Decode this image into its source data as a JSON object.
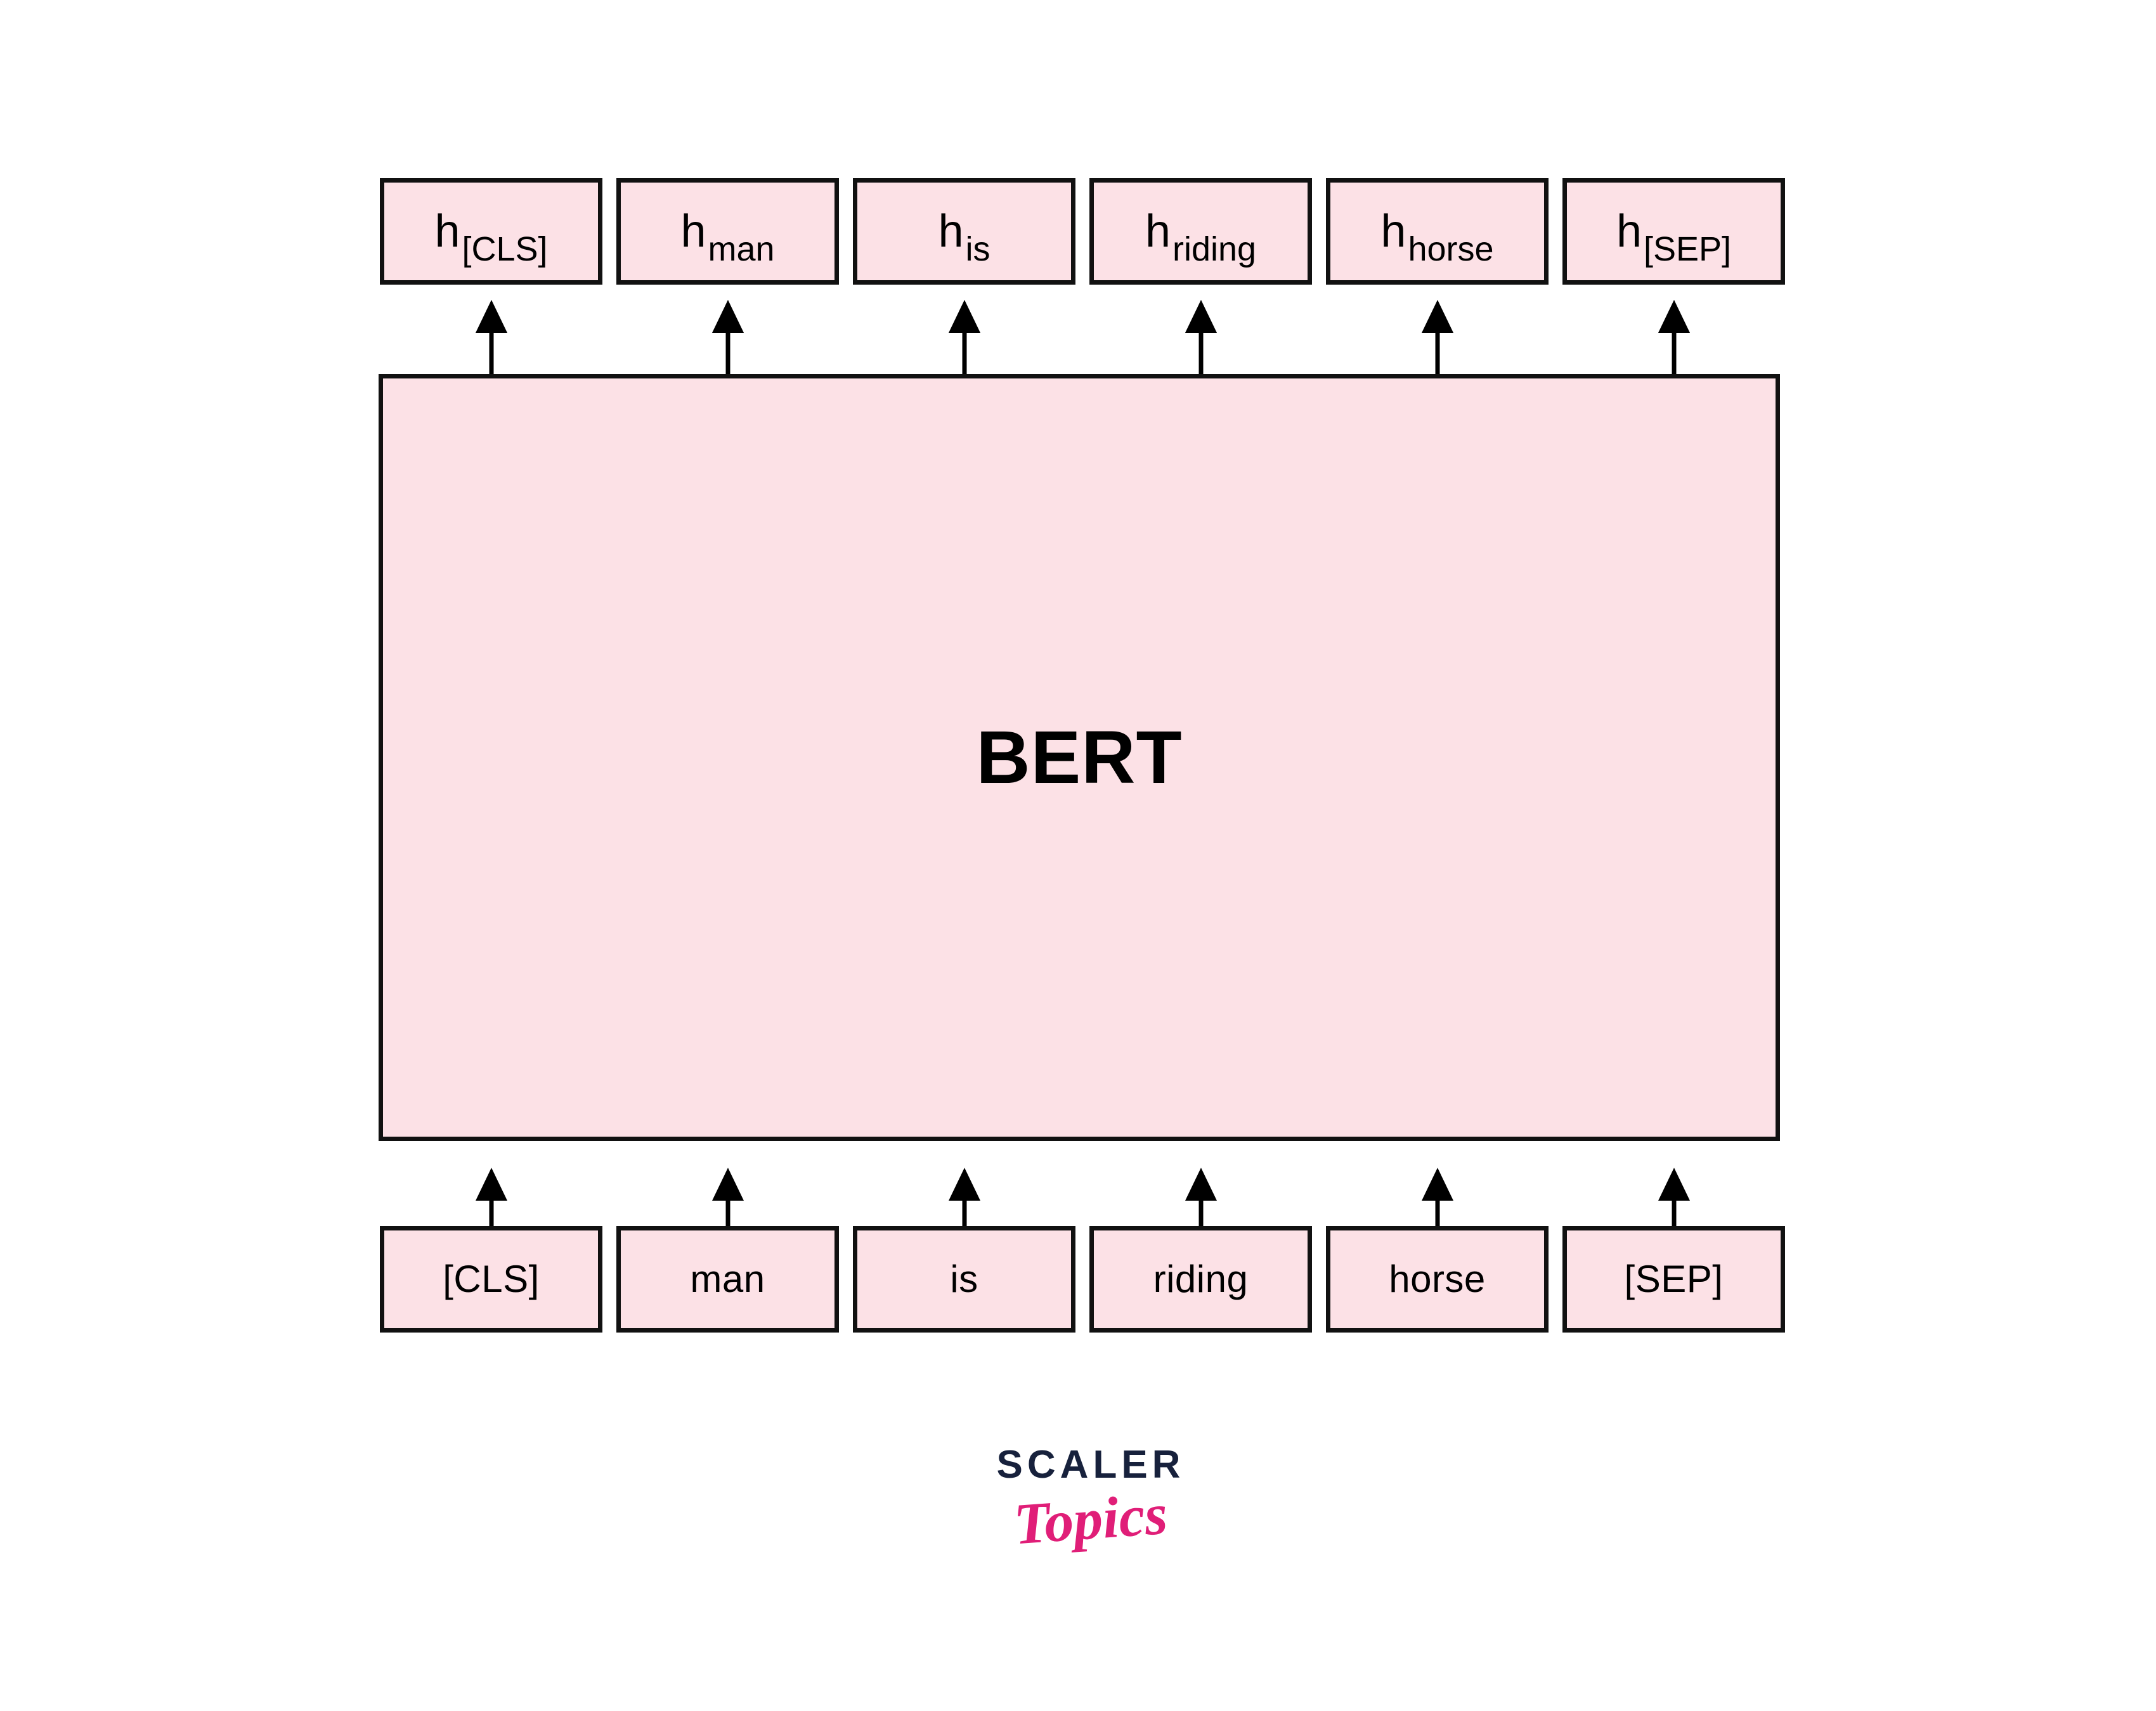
{
  "diagram": {
    "title": "BERT",
    "model_block": {
      "label": "BERT",
      "fill_color": "#FCE1E6",
      "border_color": "#111111"
    },
    "output_row": {
      "row_name": "hidden-state-outputs",
      "boxes": [
        {
          "base": "h",
          "subscript": "[CLS]",
          "full": "h [CLS]"
        },
        {
          "base": "h",
          "subscript": "man",
          "full": "h man"
        },
        {
          "base": "h",
          "subscript": "is",
          "full": "h is"
        },
        {
          "base": "h",
          "subscript": "riding",
          "full": "h riding"
        },
        {
          "base": "h",
          "subscript": "horse",
          "full": "h horse"
        },
        {
          "base": "h",
          "subscript": "[SEP]",
          "full": "h [SEP]"
        }
      ]
    },
    "input_row": {
      "row_name": "input-tokens",
      "boxes": [
        {
          "label": "[CLS]"
        },
        {
          "label": "man"
        },
        {
          "label": "is"
        },
        {
          "label": "riding"
        },
        {
          "label": "horse"
        },
        {
          "label": "[SEP]"
        }
      ]
    },
    "arrows": {
      "input_to_model_count": 6,
      "model_to_output_count": 6,
      "direction": "up",
      "color": "#000000"
    }
  },
  "logo": {
    "primary": "SCALER",
    "secondary": "Topics",
    "primary_color": "#17213C",
    "secondary_color": "#E01E78"
  }
}
